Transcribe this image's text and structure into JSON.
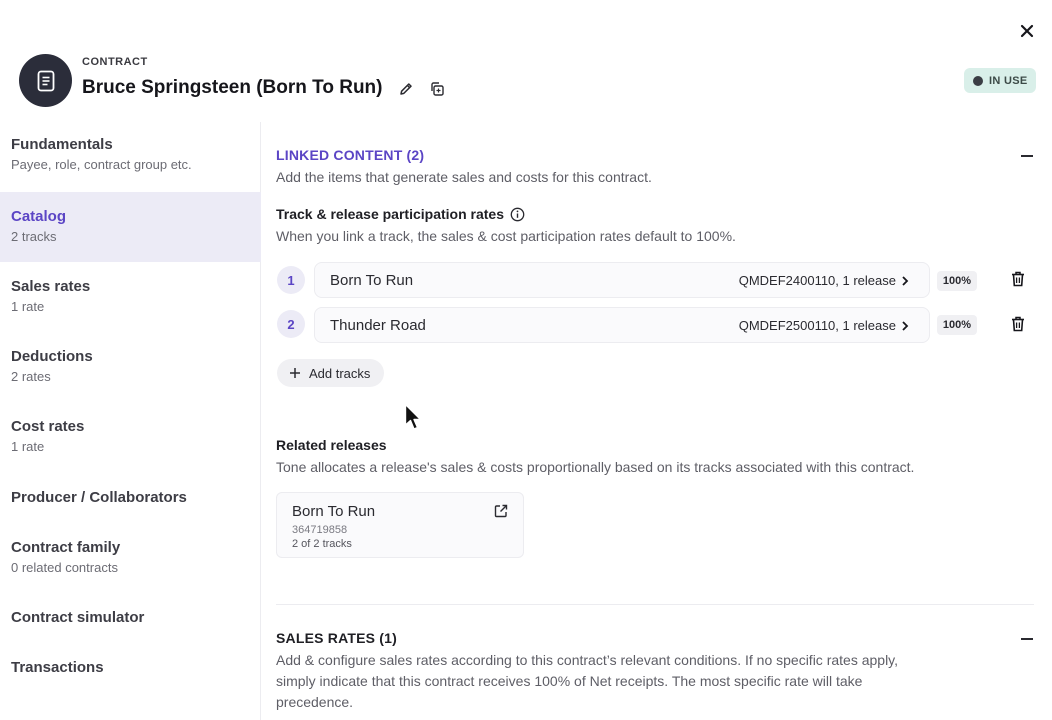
{
  "header": {
    "eyebrow": "CONTRACT",
    "title": "Bruce Springsteen (Born To Run)",
    "status": "IN USE"
  },
  "sidebar": {
    "items": [
      {
        "label": "Fundamentals",
        "sub": "Payee, role, contract group etc.",
        "active": false
      },
      {
        "label": "Catalog",
        "sub": "2 tracks",
        "active": true
      },
      {
        "label": "Sales rates",
        "sub": "1 rate",
        "active": false
      },
      {
        "label": "Deductions",
        "sub": "2 rates",
        "active": false
      },
      {
        "label": "Cost rates",
        "sub": "1 rate",
        "active": false
      },
      {
        "label": "Producer / Collaborators",
        "sub": "",
        "active": false
      },
      {
        "label": "Contract family",
        "sub": "0 related contracts",
        "active": false
      },
      {
        "label": "Contract simulator",
        "sub": "",
        "active": false
      },
      {
        "label": "Transactions",
        "sub": "",
        "active": false
      }
    ]
  },
  "linked": {
    "title": "LINKED CONTENT (2)",
    "desc": "Add the items that generate sales and costs for this contract.",
    "participation_title": "Track & release participation rates",
    "participation_desc": "When you link a track, the sales & cost participation rates default to 100%.",
    "tracks": [
      {
        "num": "1",
        "name": "Born To Run",
        "meta": "QMDEF2400110, 1 release",
        "pct": "100%"
      },
      {
        "num": "2",
        "name": "Thunder Road",
        "meta": "QMDEF2500110, 1 release",
        "pct": "100%"
      }
    ],
    "add_label": "Add tracks"
  },
  "related": {
    "title": "Related releases",
    "desc": "Tone allocates a release's sales & costs proportionally based on its tracks associated with this contract.",
    "release": {
      "title": "Born To Run",
      "code": "364719858",
      "tracks": "2 of 2 tracks"
    }
  },
  "sales": {
    "title": "SALES RATES (1)",
    "desc_1": "Add & configure sales rates according to this contract’s relevant conditions. If no specific rates apply,",
    "desc_2": "simply indicate that this contract receives 100% of Net receipts. The most specific rate will take",
    "desc_3": "precedence."
  },
  "colors": {
    "accent": "#5b45c5",
    "status_bg": "#d9efe9",
    "active_bg": "#ecebf6"
  }
}
